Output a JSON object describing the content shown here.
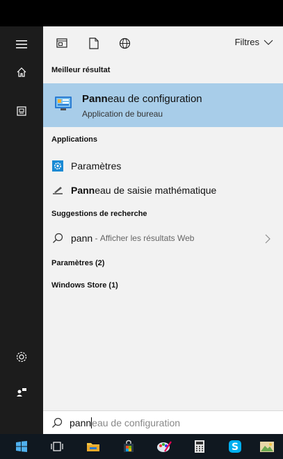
{
  "toolbar": {
    "filters_label": "Filtres"
  },
  "sections": {
    "best_result": "Meilleur résultat",
    "applications": "Applications",
    "suggestions": "Suggestions de recherche",
    "settings": "Paramètres (2)",
    "store": "Windows Store (1)"
  },
  "best_result": {
    "title_bold": "Pann",
    "title_rest": "eau de configuration",
    "subtitle": "Application de bureau"
  },
  "applications": [
    {
      "bold": "",
      "rest": "Paramètres"
    },
    {
      "bold": "Pann",
      "rest": "eau de saisie mathématique"
    }
  ],
  "suggestion": {
    "term": "pann",
    "dash": " - ",
    "action": "Afficher les résultats Web"
  },
  "search": {
    "typed": "pann",
    "autocomplete": "eau de configuration"
  },
  "colors": {
    "highlight": "#a8cde9",
    "panel_bg": "#f2f2f2",
    "sidebar_bg": "#1c1c1c",
    "taskbar_bg": "#101820",
    "accent": "#1a8ad4"
  },
  "icons": {
    "sidebar": [
      "hamburger-menu-icon",
      "home-icon",
      "notebook-icon",
      "settings-gear-icon",
      "feedback-icon"
    ],
    "toolbar": [
      "apps-filter-icon",
      "documents-filter-icon",
      "web-filter-icon"
    ],
    "taskbar": [
      "start-windows-icon",
      "task-view-icon",
      "file-explorer-icon",
      "store-icon",
      "paint-icon",
      "calculator-icon",
      "skype-icon",
      "photos-icon"
    ]
  }
}
